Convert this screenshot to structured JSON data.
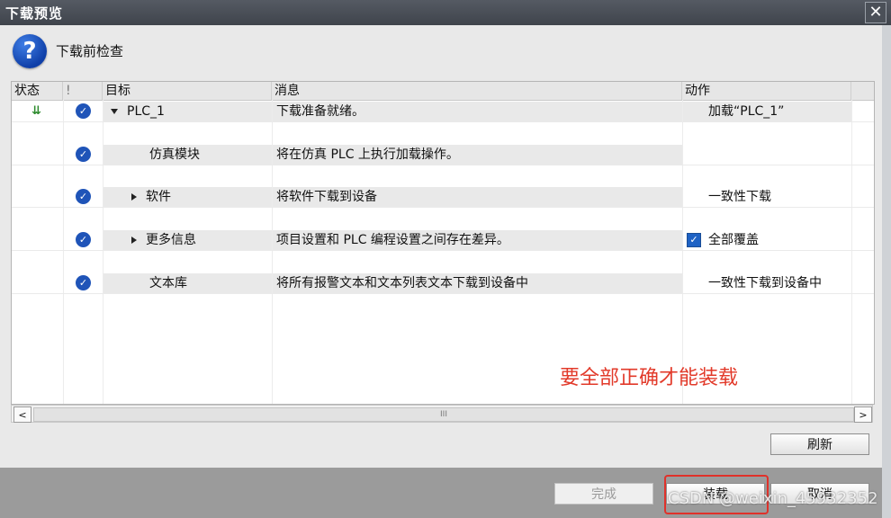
{
  "dialog": {
    "title": "下载预览",
    "close_label": "✕"
  },
  "header": {
    "title": "下载前检查",
    "icon": "question-icon"
  },
  "table": {
    "columns": [
      "状态",
      "!",
      "目标",
      "消息",
      "动作"
    ],
    "rows": [
      {
        "target": "PLC_1",
        "message": "下载准备就绪。",
        "action": "加载“PLC_1”"
      },
      {
        "target": "仿真模块",
        "message": "将在仿真 PLC 上执行加载操作。",
        "action": ""
      },
      {
        "target": "软件",
        "message": "将软件下载到设备",
        "action": "一致性下载"
      },
      {
        "target": "更多信息",
        "message": "项目设置和 PLC 编程设置之间存在差异。",
        "action": "全部覆盖"
      },
      {
        "target": "文本库",
        "message": "将所有报警文本和文本列表文本下载到设备中",
        "action": "一致性下载到设备中"
      }
    ]
  },
  "scrollbar": {
    "left_arrow": "<",
    "right_arrow": ">",
    "thumb_grip": "III"
  },
  "buttons": {
    "refresh": "刷新",
    "finish": "完成",
    "load": "装载",
    "cancel": "取消"
  },
  "annotation": {
    "note": "要全部正确才能装载"
  },
  "watermark": "CSDN @weixin_45932352",
  "colors": {
    "accent": "#1f54b8",
    "annotation": "#e23a2a"
  }
}
